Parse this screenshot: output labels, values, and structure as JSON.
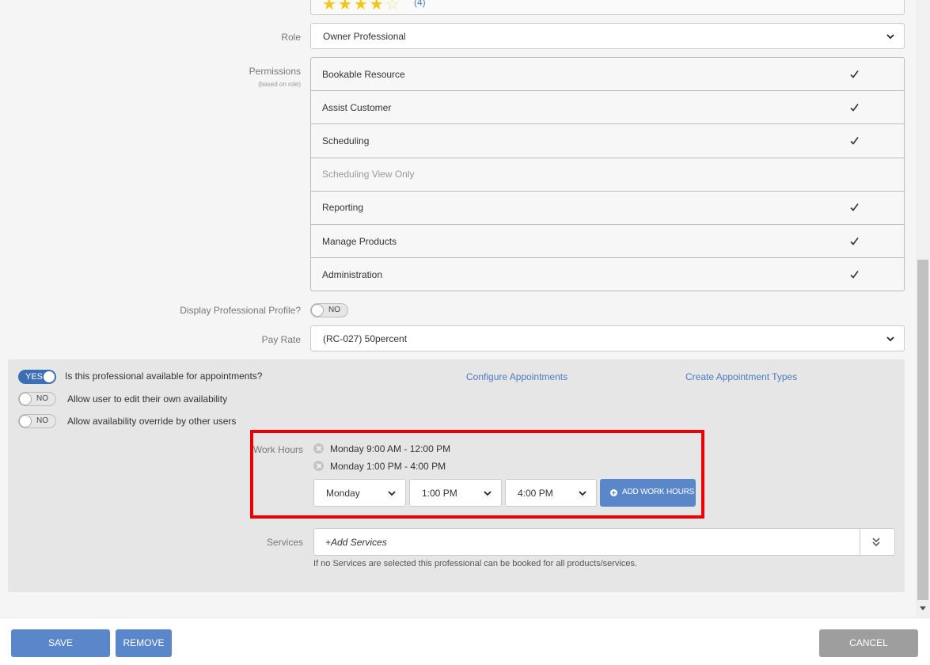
{
  "rating": {
    "stars_filled": 4,
    "stars_total": 5,
    "count_label": "(4)"
  },
  "role": {
    "label": "Role",
    "value": "Owner Professional"
  },
  "permissions": {
    "label": "Permissions",
    "sublabel": "(based on role)",
    "items": [
      {
        "label": "Bookable Resource",
        "checked": true,
        "enabled": true
      },
      {
        "label": "Assist Customer",
        "checked": true,
        "enabled": true
      },
      {
        "label": "Scheduling",
        "checked": true,
        "enabled": true
      },
      {
        "label": "Scheduling View Only",
        "checked": false,
        "enabled": false
      },
      {
        "label": "Reporting",
        "checked": true,
        "enabled": true
      },
      {
        "label": "Manage Products",
        "checked": true,
        "enabled": true
      },
      {
        "label": "Administration",
        "checked": true,
        "enabled": true
      }
    ]
  },
  "display_profile": {
    "label": "Display Professional Profile?",
    "toggle": "NO"
  },
  "pay_rate": {
    "label": "Pay Rate",
    "value": "(RC-027) 50percent"
  },
  "availability": {
    "available": {
      "toggle": "YES",
      "label": "Is this professional available for appointments?"
    },
    "edit_own": {
      "toggle": "NO",
      "label": "Allow user to edit their own availability"
    },
    "override": {
      "toggle": "NO",
      "label": "Allow availability override by other users"
    },
    "configure_link": "Configure Appointments",
    "create_types_link": "Create Appointment Types"
  },
  "work_hours": {
    "label": "Work Hours",
    "entries": [
      "Monday 9:00 AM - 12:00 PM",
      "Monday 1:00 PM - 4:00 PM"
    ],
    "day_select": "Monday",
    "start_select": "1:00 PM",
    "end_select": "4:00 PM",
    "add_button": "ADD WORK HOURS"
  },
  "services": {
    "label": "Services",
    "placeholder": "+Add Services",
    "hint": "If no Services are selected this professional can be booked for all products/services."
  },
  "footer": {
    "save": "SAVE",
    "remove": "REMOVE",
    "cancel": "CANCEL"
  },
  "colors": {
    "accent": "#5a87c9",
    "toggle_on": "#3a6fb7",
    "link": "#4a7cc1",
    "highlight": "#e00000",
    "cancel": "#9e9e9e"
  }
}
